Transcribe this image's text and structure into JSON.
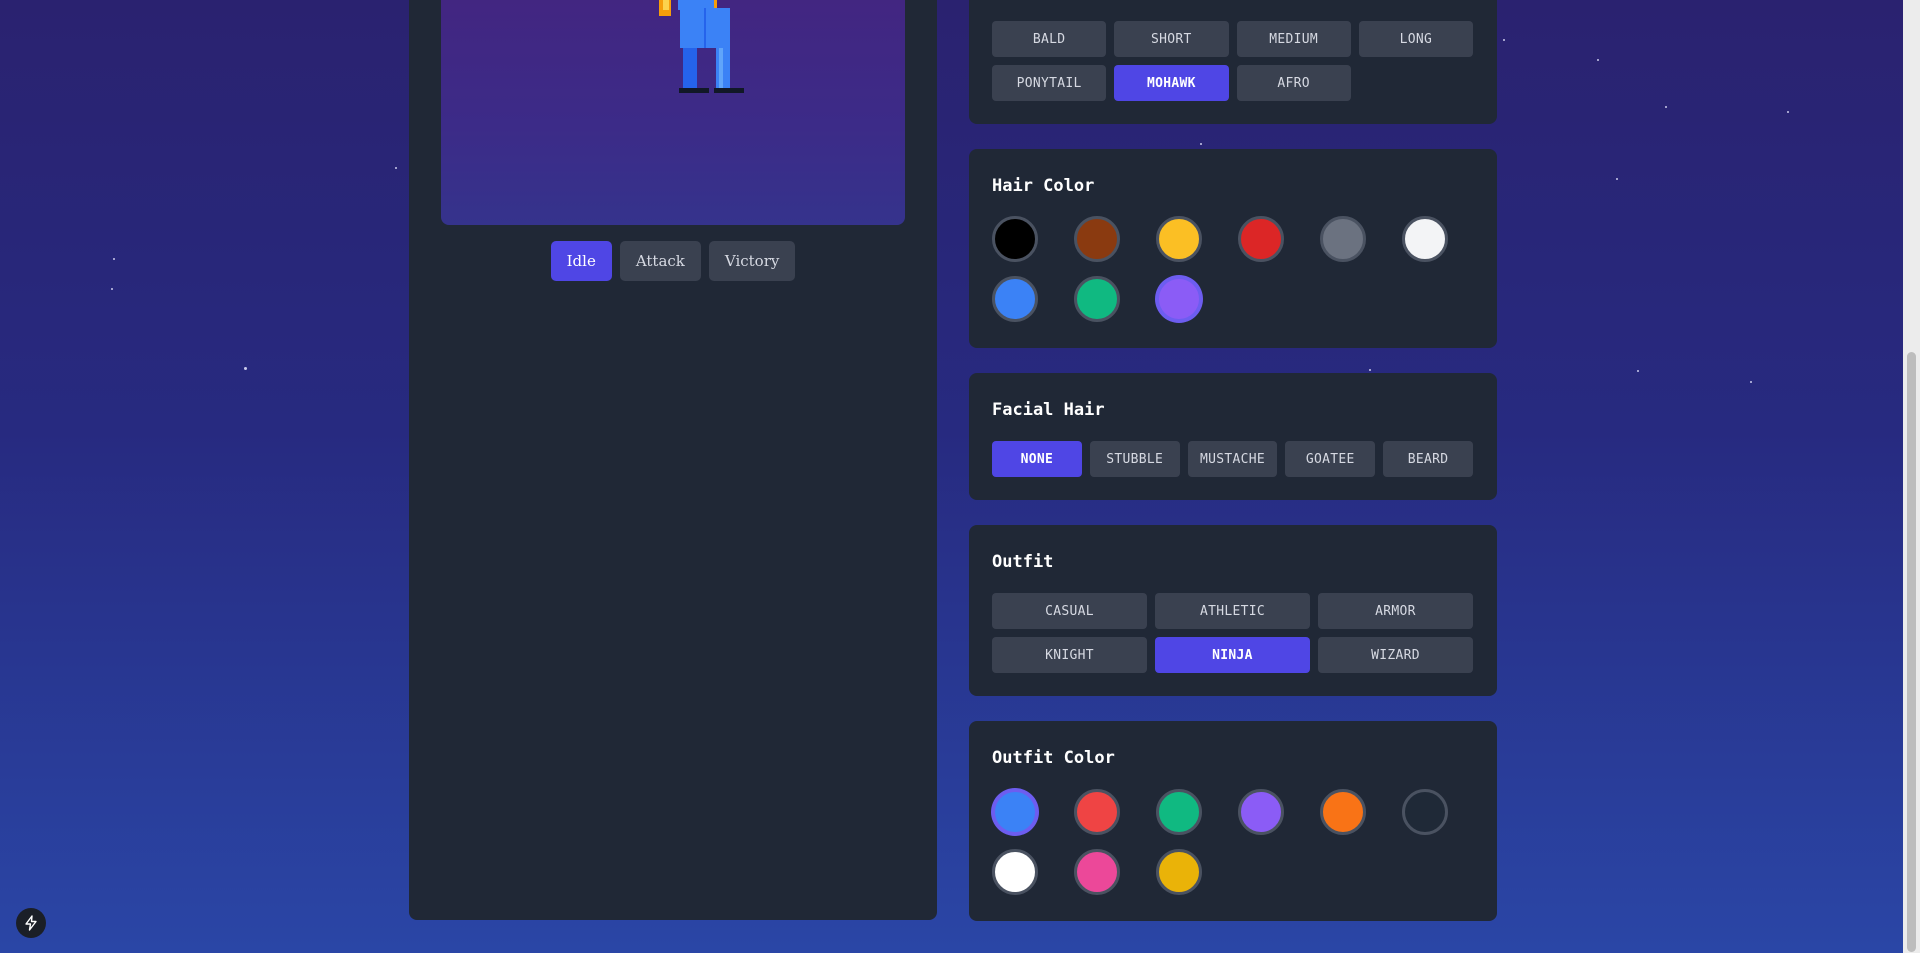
{
  "animation_tabs": [
    {
      "label": "Idle",
      "active": true
    },
    {
      "label": "Attack",
      "active": false
    },
    {
      "label": "Victory",
      "active": false
    }
  ],
  "hair_style": {
    "options": [
      "BALD",
      "SHORT",
      "MEDIUM",
      "LONG",
      "PONYTAIL",
      "MOHAWK",
      "AFRO"
    ],
    "selected": "MOHAWK"
  },
  "hair_color": {
    "title": "Hair Color",
    "colors": [
      "#000000",
      "#8a3a10",
      "#fbbf24",
      "#dc2626",
      "#6b7280",
      "#f3f4f6",
      "#3b82f6",
      "#10b981",
      "#8b5cf6"
    ],
    "selected_index": 8
  },
  "facial_hair": {
    "title": "Facial Hair",
    "options": [
      "NONE",
      "STUBBLE",
      "MUSTACHE",
      "GOATEE",
      "BEARD"
    ],
    "selected": "NONE"
  },
  "outfit": {
    "title": "Outfit",
    "options": [
      "CASUAL",
      "ATHLETIC",
      "ARMOR",
      "KNIGHT",
      "NINJA",
      "WIZARD"
    ],
    "selected": "NINJA"
  },
  "outfit_color": {
    "title": "Outfit Color",
    "colors": [
      "#3b82f6",
      "#ef4444",
      "#10b981",
      "#8b5cf6",
      "#f97316",
      "#1f2937",
      "#ffffff",
      "#ec4899",
      "#eab308"
    ],
    "selected_index": 0
  },
  "help_button": {
    "icon": "bolt-icon"
  },
  "colors": {
    "accent": "#4f46e5",
    "panel": "#202836",
    "button": "#3a4150"
  }
}
